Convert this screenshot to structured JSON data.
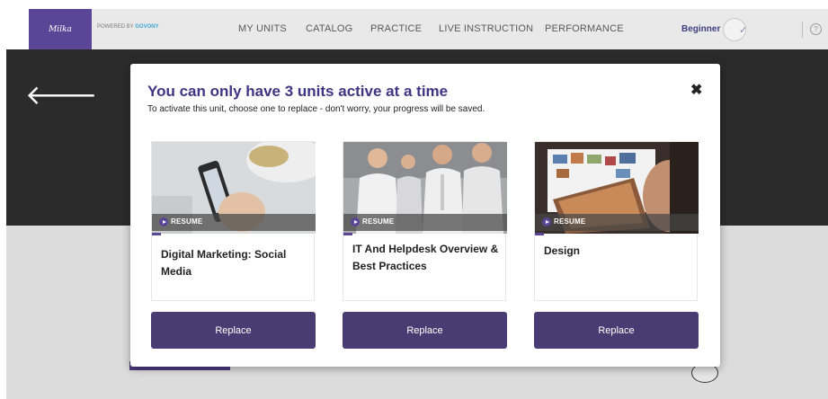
{
  "nav": {
    "logo_text": "Milka",
    "powered_prefix": "POWERED BY",
    "powered_brand": "GOVONY",
    "links": [
      "MY UNITS",
      "CATALOG",
      "PRACTICE",
      "LIVE INSTRUCTION",
      "PERFORMANCE"
    ],
    "level": "Beginner",
    "check_glyph": "✓",
    "help_glyph": "?"
  },
  "hero": {
    "back_glyph": "🡐"
  },
  "modal": {
    "title": "You can only have 3 units active at a time",
    "subtitle": "To activate this unit, choose one to replace - don't worry, your progress will be saved.",
    "close_glyph": "✖",
    "resume_label": "RESUME",
    "replace_label": "Replace",
    "units": [
      {
        "title": "Digital Marketing: Social Media"
      },
      {
        "title": "IT And Helpdesk Overview & Best Practices"
      },
      {
        "title": "Design"
      }
    ]
  },
  "colors": {
    "brand_purple": "#5a4596",
    "title_purple": "#3f3683",
    "button_purple": "#473d72",
    "hero_dark": "#2b2b2b"
  }
}
